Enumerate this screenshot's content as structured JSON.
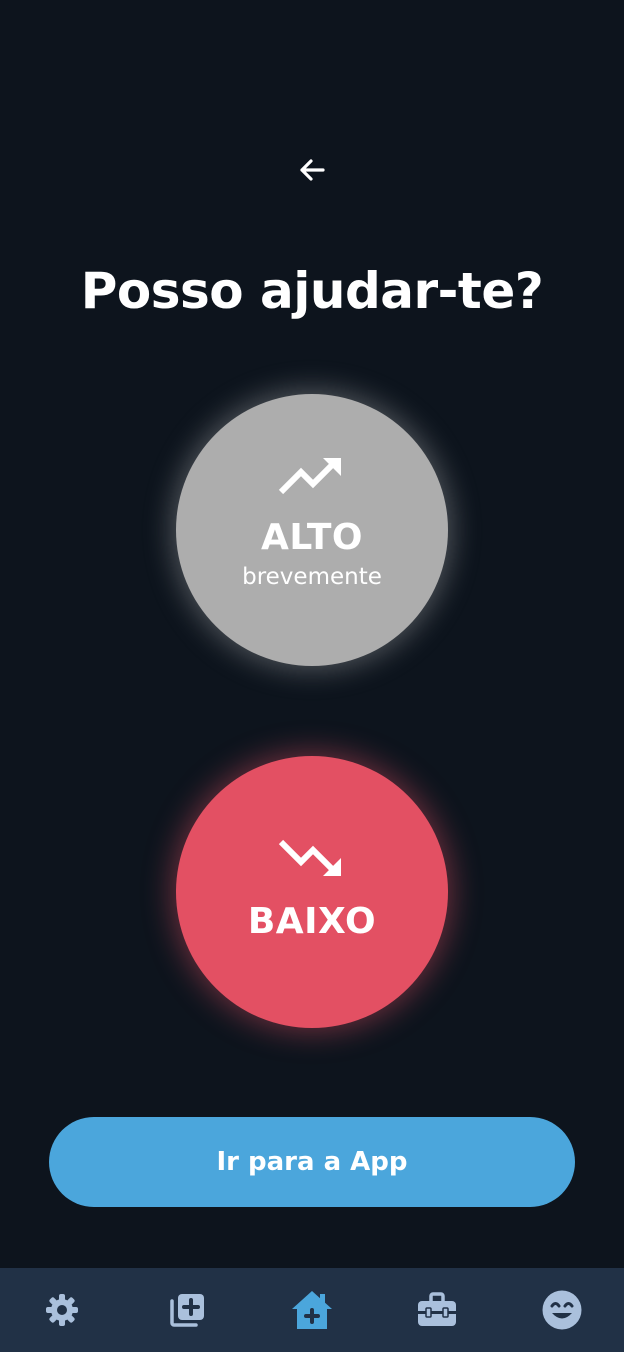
{
  "header": {
    "back_icon": "arrow-left-icon",
    "title": "Posso ajudar-te?"
  },
  "options": {
    "high": {
      "icon": "trending-up-icon",
      "label": "ALTO",
      "sublabel": "brevemente",
      "color": "#adadad"
    },
    "low": {
      "icon": "trending-down-icon",
      "label": "BAIXO",
      "color": "#e35063"
    }
  },
  "cta": {
    "label": "Ir para a App",
    "color": "#4ba6dc"
  },
  "tabbar": {
    "background": "#213146",
    "inactive_color": "#aac0dc",
    "active_color": "#4ba6dc",
    "items": [
      {
        "icon": "gear-icon",
        "active": false
      },
      {
        "icon": "add-to-queue-icon",
        "active": false
      },
      {
        "icon": "home-plus-icon",
        "active": true
      },
      {
        "icon": "toolbox-icon",
        "active": false
      },
      {
        "icon": "smiley-face-icon",
        "active": false
      }
    ]
  },
  "colors": {
    "background": "#0d141d",
    "text": "#ffffff"
  }
}
